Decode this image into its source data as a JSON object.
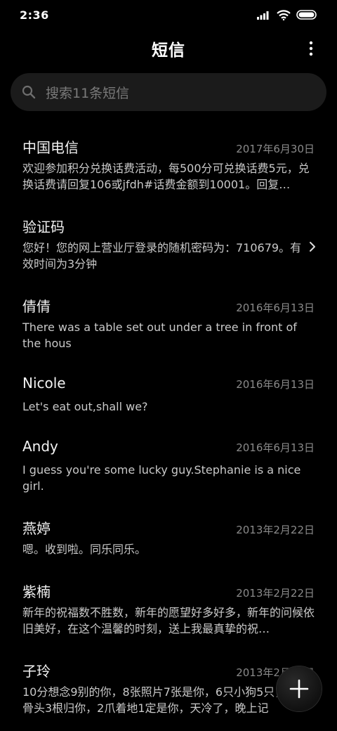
{
  "status_bar": {
    "time": "2:36"
  },
  "header": {
    "title": "短信"
  },
  "search": {
    "placeholder": "搜索11条短信"
  },
  "messages": [
    {
      "name": "中国电信",
      "date": "2017年6月30日",
      "preview": "欢迎参加积分兑换话费活动，每500分可兑换话费5元，兑换话费请回复106或jfdh#话费金额到10001。回复…"
    },
    {
      "name": "验证码",
      "date": "",
      "preview": "您好！您的网上营业厅登录的随机密码为：710679。有效时间为3分钟"
    },
    {
      "name": "倩倩",
      "date": "2016年6月13日",
      "preview": "There was a table set out under a tree in front of the hous"
    },
    {
      "name": "Nicole",
      "date": "2016年6月13日",
      "preview": "Let's eat out,shall we?"
    },
    {
      "name": "Andy",
      "date": "2016年6月13日",
      "preview": "I guess you're some lucky guy.Stephanie is a nice girl."
    },
    {
      "name": "燕婷",
      "date": "2013年2月22日",
      "preview": "嗯。收到啦。同乐同乐。"
    },
    {
      "name": "紫楠",
      "date": "2013年2月22日",
      "preview": "新年的祝福数不胜数，新年的愿望好多好多，新年的问候依旧美好，在这个温馨的时刻，送上我最真挚的祝…"
    },
    {
      "name": "子玲",
      "date": "2013年2月22日",
      "preview": "10分想念9别的你，8张照片7张是你，6只小狗5只，4根骨头3根归你，2爪着地1定是你，天冷了，晚上记"
    }
  ],
  "icons": {
    "search": "search-icon",
    "more": "more-vertical-icon",
    "chevron": "chevron-right-icon",
    "compose": "plus-icon"
  }
}
